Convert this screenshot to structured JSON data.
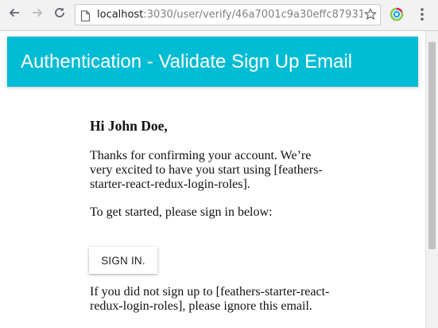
{
  "browser": {
    "url_host": "localhost",
    "url_rest": ":3030/user/verify/46a7001c9a30effc87931("
  },
  "app_bar": {
    "title": "Authentication - Validate Sign Up Email",
    "color": "#00bcd4"
  },
  "email": {
    "greeting": "Hi John Doe,",
    "intro": "Thanks for confirming your account. We’re very excited to have you start using [feathers-starter-react-redux-login-roles].",
    "get_started": "To get started, please sign in below:",
    "signin_label": "SIGN IN.",
    "footer": "If you did not sign up to [feathers-starter-react-redux-login-roles], please ignore this email."
  },
  "icons": [
    "back-icon",
    "forward-icon",
    "reload-icon",
    "page-icon",
    "star-icon",
    "extension-icon",
    "menu-icon"
  ]
}
